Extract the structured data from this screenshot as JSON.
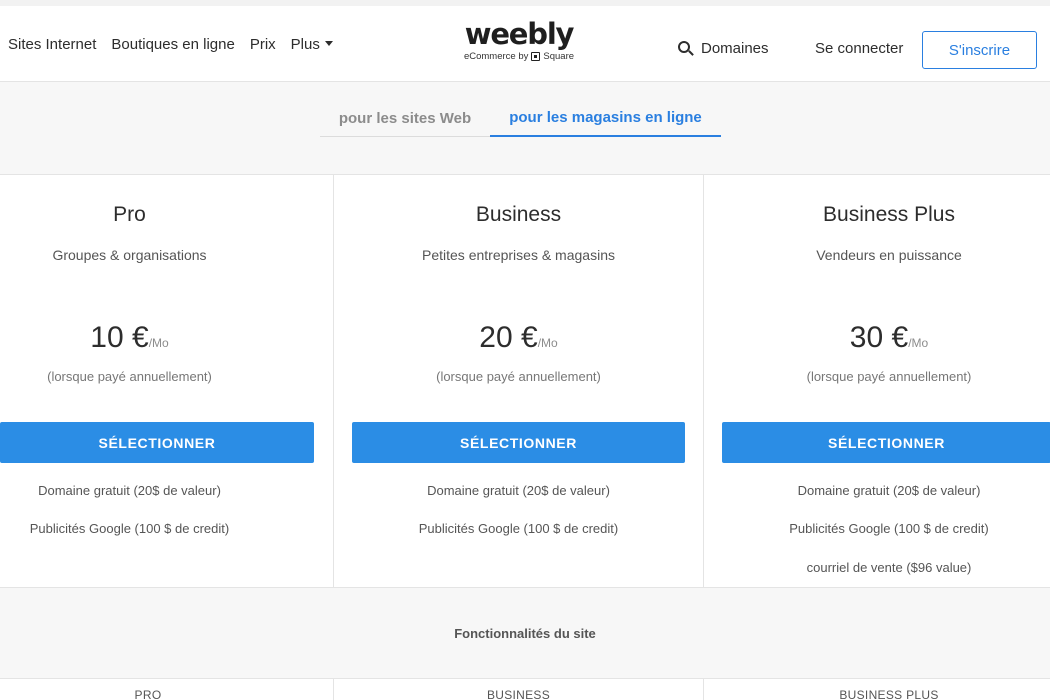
{
  "header": {
    "nav": [
      {
        "label": "Sites Internet"
      },
      {
        "label": "Boutiques en ligne"
      },
      {
        "label": "Prix"
      },
      {
        "label": "Plus"
      }
    ],
    "logo": {
      "word": "weebly",
      "sub_prefix": "eCommerce by",
      "sub_brand": "Square"
    },
    "domains_label": "Domaines",
    "login_label": "Se connecter",
    "signup_label": "S'inscrire",
    "accent_color": "#2a7fe0"
  },
  "tabs": [
    {
      "label": "pour les sites Web",
      "active": false
    },
    {
      "label": "pour les magasins en ligne",
      "active": true
    }
  ],
  "plans": [
    {
      "name": "Pro",
      "description": "Groupes & organisations",
      "price": "10 €",
      "unit": "/Mo",
      "billing": "(lorsque payé annuellement)",
      "button": "SÉLECTIONNER",
      "features": [
        "Domaine gratuit (20$ de valeur)",
        "Publicités Google (100 $ de credit)"
      ]
    },
    {
      "name": "Business",
      "description": "Petites entreprises & magasins",
      "price": "20 €",
      "unit": "/Mo",
      "billing": "(lorsque payé annuellement)",
      "button": "SÉLECTIONNER",
      "features": [
        "Domaine gratuit (20$ de valeur)",
        "Publicités Google (100 $ de credit)"
      ]
    },
    {
      "name": "Business Plus",
      "description": "Vendeurs en puissance",
      "price": "30 €",
      "unit": "/Mo",
      "billing": "(lorsque payé annuellement)",
      "button": "SÉLECTIONNER",
      "features": [
        "Domaine gratuit (20$ de valeur)",
        "Publicités Google (100 $ de credit)",
        "courriel de vente ($96 value)"
      ]
    }
  ],
  "features_section": {
    "title": "Fonctionnalités du site",
    "plan_headers": [
      "PRO",
      "BUSINESS",
      "BUSINESS PLUS"
    ]
  },
  "button_color": "#2b8de5"
}
